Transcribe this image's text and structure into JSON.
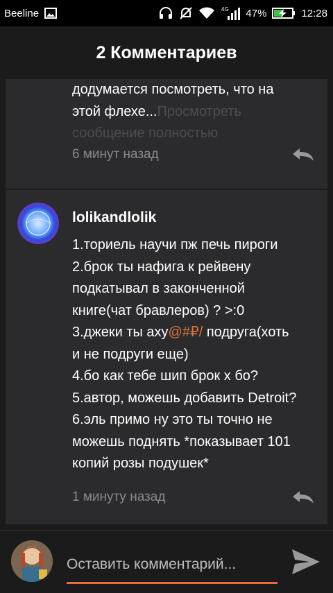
{
  "status_bar": {
    "carrier": "Beeline",
    "network": "4G",
    "battery": "47%",
    "time": "12:28",
    "icons": [
      "image-icon",
      "headset-icon",
      "mute-icon",
      "wifi-icon",
      "signal-icon",
      "battery-charging-icon"
    ]
  },
  "header": {
    "title": "2 Комментариев"
  },
  "comments": [
    {
      "lines": [
        "додумается посмотреть, что на",
        "этой флехе..."
      ],
      "read_more_line1": "Просмотреть",
      "read_more_line2": "сообщение полностью",
      "time": "6 минут назад",
      "reply_icon": "reply-icon"
    },
    {
      "author": "lolikandlolik",
      "avatar_icon": "avatar-icon",
      "lines": [
        "1.ториель научи пж печь пироги",
        "2.брок ты нафига к рейвену",
        "подкатывал в законченной",
        "книге(чат бравлеров) ? >:0",
        "3.джеки ты аху",
        "и не подруги еще)",
        "4.бо как тебе шип брок х  бо?",
        "5.автор, можешь добавить Detroit?",
        "6.эль примо ну это ты точно не",
        "можешь поднять *показывает 101",
        "копий розы подушек*"
      ],
      "censored": "@#₽/",
      "line5_tail": " подруга(хоть",
      "time": "1 минуту назад",
      "reply_icon": "reply-icon"
    }
  ],
  "composer": {
    "avatar_icon": "my-avatar-icon",
    "placeholder": "Оставить комментарий...",
    "send_icon": "send-icon",
    "accent_color": "#ec6a3c"
  }
}
